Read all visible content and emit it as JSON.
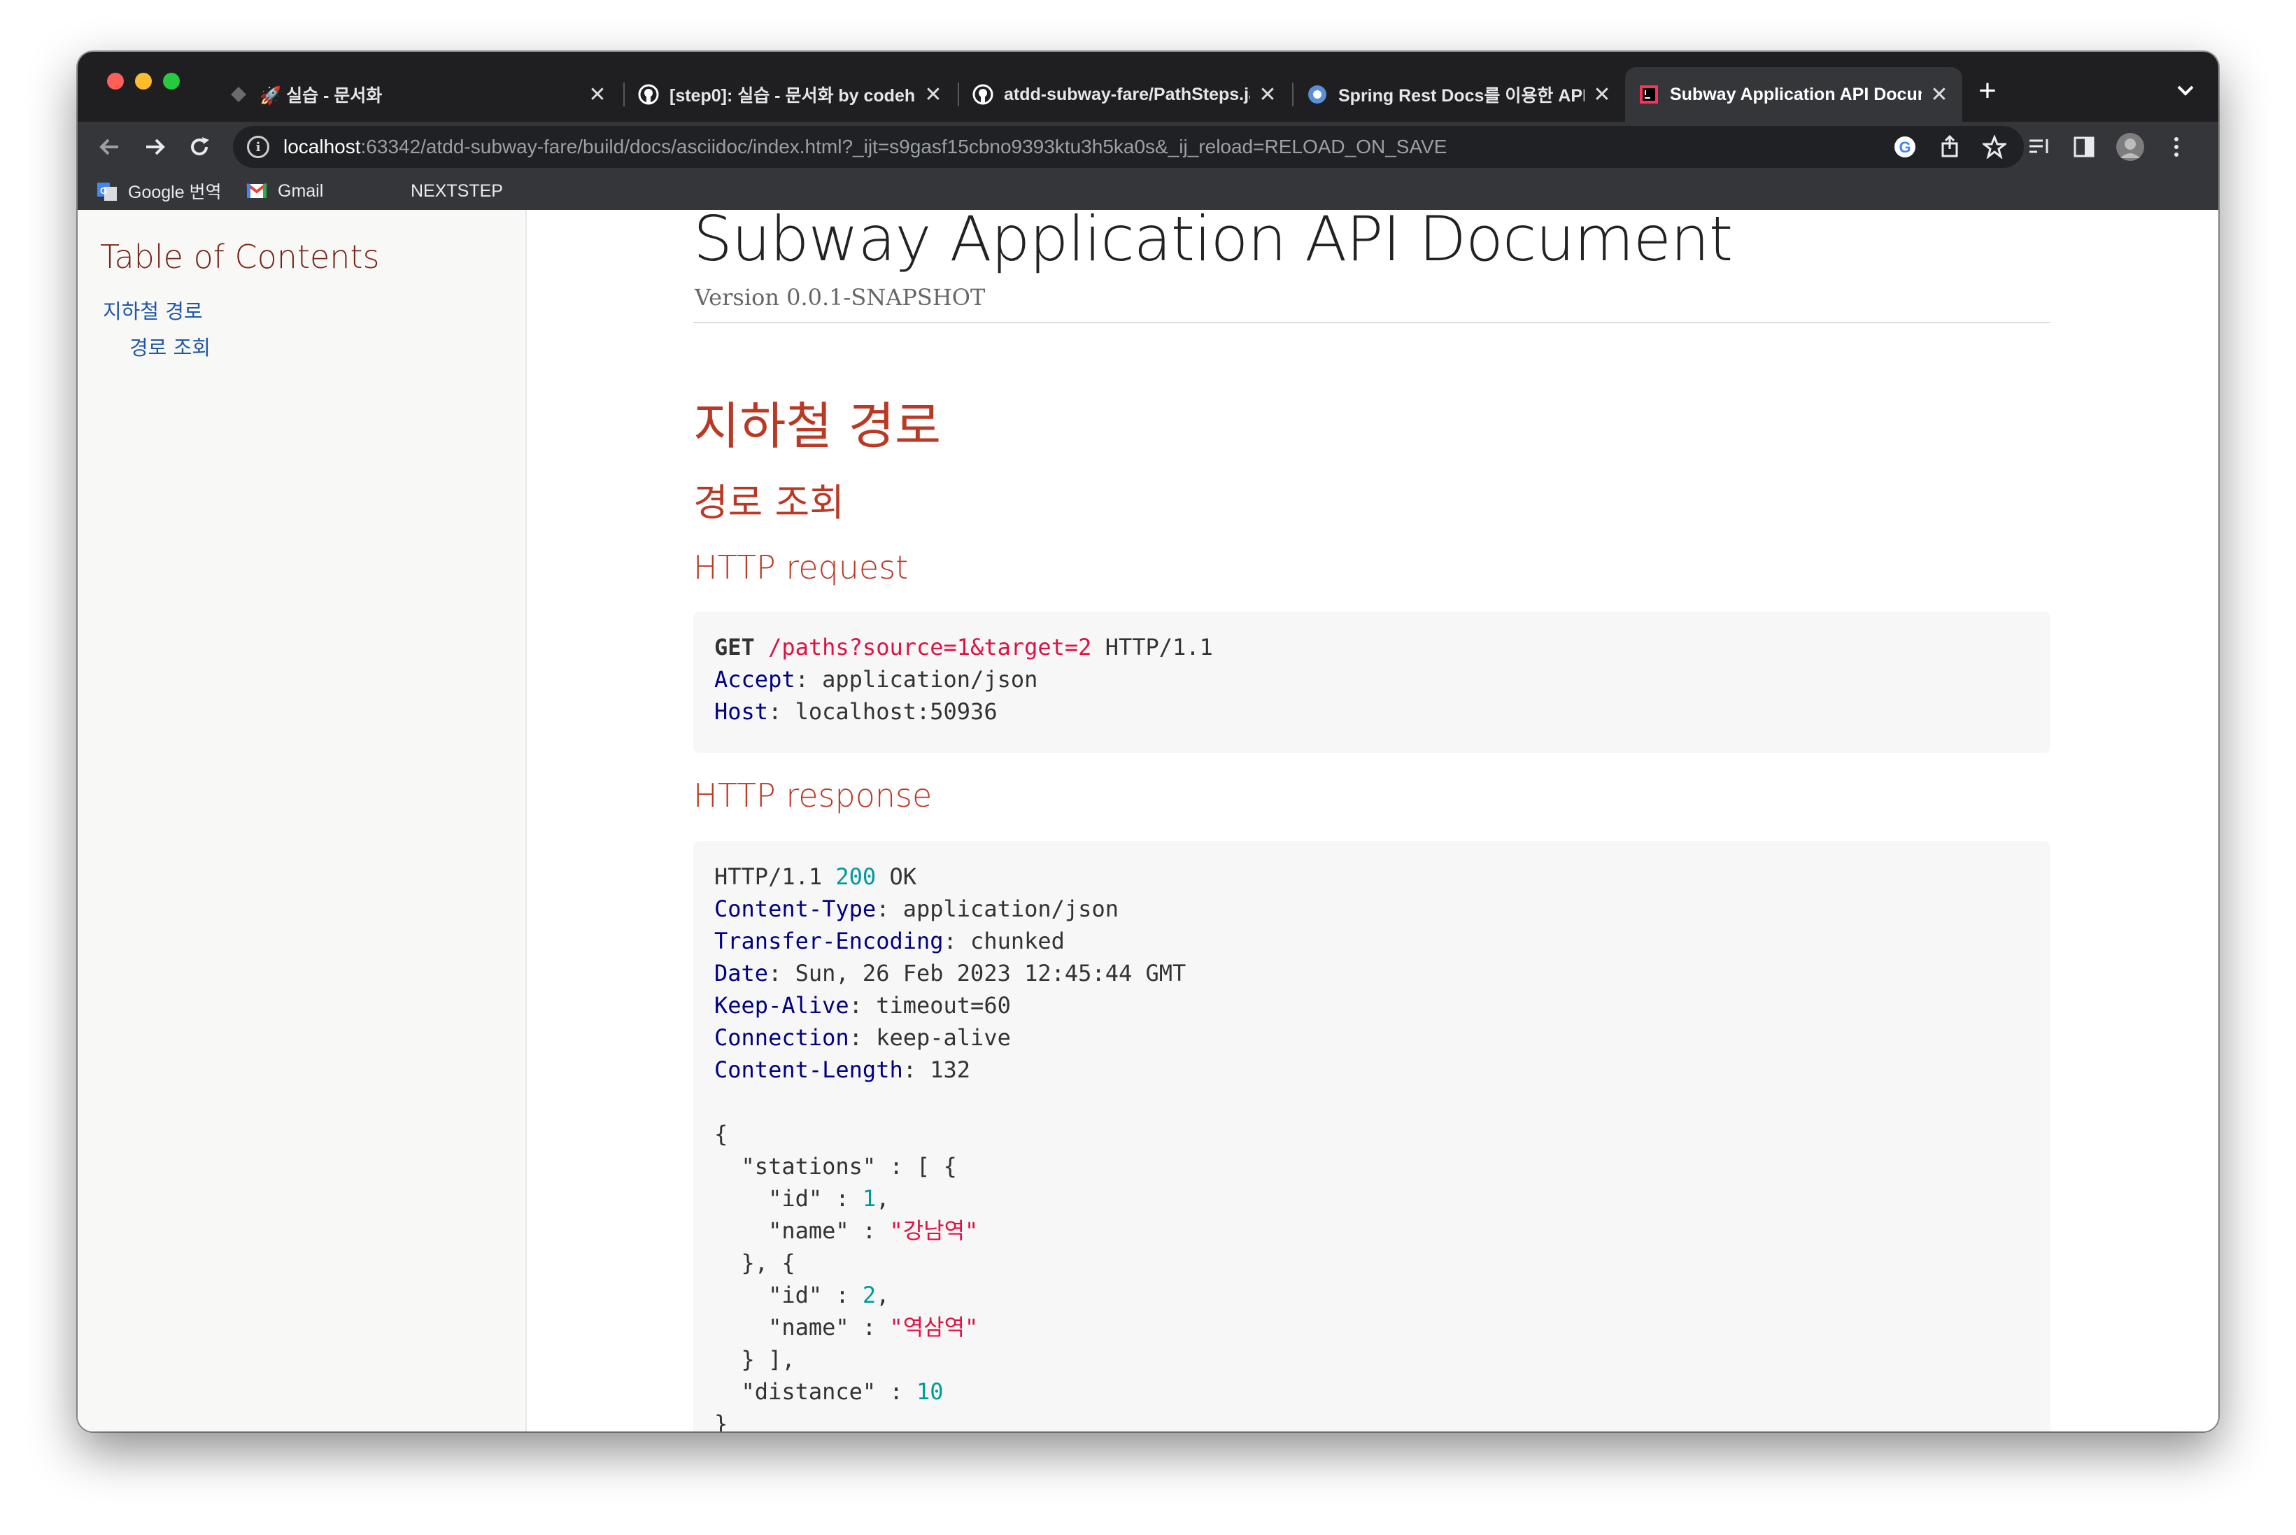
{
  "browser": {
    "tabs": [
      {
        "icon": "rocket-icon",
        "label": "🚀 실습 - 문서화"
      },
      {
        "icon": "github-icon",
        "label": "[step0]: 실습 - 문서화 by codehc"
      },
      {
        "icon": "github-icon",
        "label": "atdd-subway-fare/PathSteps.ja"
      },
      {
        "icon": "spring-icon",
        "label": "Spring Rest Docs를 이용한 API 문"
      },
      {
        "icon": "intellij-icon",
        "label": "Subway Application API Docum"
      }
    ],
    "url_host": "localhost",
    "url_rest": ":63342/atdd-subway-fare/build/docs/asciidoc/index.html?_ijt=s9gasf15cbno9393ktu3h5ka0s&_ij_reload=RELOAD_ON_SAVE",
    "bookmarks": [
      {
        "icon": "google-translate-icon",
        "label": "Google 번역"
      },
      {
        "icon": "gmail-icon",
        "label": "Gmail"
      },
      {
        "icon": "",
        "label": "NEXTSTEP"
      }
    ]
  },
  "toc": {
    "title": "Table of Contents",
    "items": [
      {
        "label": "지하철 경로"
      },
      {
        "label": "경로 조회"
      }
    ]
  },
  "doc": {
    "title": "Subway Application API Document",
    "version": "Version 0.0.1-SNAPSHOT",
    "section": "지하철 경로",
    "subsection": "경로 조회",
    "request_heading": "HTTP request",
    "request": {
      "method": "GET",
      "path": "/paths?source=1&target=2",
      "protocol": "HTTP/1.1",
      "headers": [
        {
          "key": "Accept",
          "value": "application/json"
        },
        {
          "key": "Host",
          "value": "localhost:50936"
        }
      ]
    },
    "response_heading": "HTTP response",
    "response": {
      "protocol": "HTTP/1.1",
      "status_code": "200",
      "status_text": "OK",
      "headers": [
        {
          "key": "Content-Type",
          "value": "application/json"
        },
        {
          "key": "Transfer-Encoding",
          "value": "chunked"
        },
        {
          "key": "Date",
          "value": "Sun, 26 Feb 2023 12:45:44 GMT"
        },
        {
          "key": "Keep-Alive",
          "value": "timeout=60"
        },
        {
          "key": "Connection",
          "value": "keep-alive"
        },
        {
          "key": "Content-Length",
          "value": "132"
        }
      ],
      "body": {
        "stations": [
          {
            "id": "1",
            "name": "\"강남역\""
          },
          {
            "id": "2",
            "name": "\"역삼역\""
          }
        ],
        "distance": "10"
      }
    }
  }
}
